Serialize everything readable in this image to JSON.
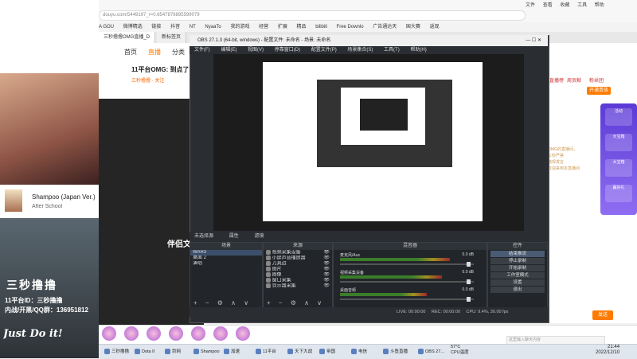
{
  "browser": {
    "url": "douyu.com/5449197_r=0.6547876895599079",
    "menu": [
      "文件",
      "查看",
      "收藏",
      "工具",
      "帮助"
    ],
    "bookmarks": [
      "A GOU",
      "微博精选",
      "链接",
      "抖音",
      "NT",
      "NyaaTo",
      "我的游戏",
      "经营",
      "扩展",
      "精品",
      "bilibili",
      "Free Downlo",
      "广告通达天",
      "国大赛",
      "返现"
    ],
    "tabs": [
      "三秒撸撸OMG直播_D",
      "新标签页"
    ]
  },
  "site": {
    "nav": [
      "首页",
      "直播",
      "分类"
    ],
    "room_title": "11平台OMG: 到点了",
    "room_sub": "三秒撸撸 · 关注",
    "caption": "伴侣文",
    "right_tabs": [
      "直播榜",
      "周贡献",
      "粉丝团"
    ],
    "open_button": "开通贵族",
    "chat_lines": [
      "OMG的直播间，",
      "三秒严禁",
      "违规发言",
      "欢迎来到本直播间"
    ],
    "promo": [
      "活动",
      "大宝箱",
      "大宝箱",
      "赢好礼"
    ],
    "send_button": "发送",
    "chat_placeholder": "这里输入聊天内容"
  },
  "left_overlay": {
    "now_playing_title": "Shampoo (Japan Ver.)",
    "now_playing_artist": "After School",
    "cam_title": "三秒撸撸",
    "cam_line1": "11平台ID：三秒撸撸",
    "cam_line2": "内战/开黑/QQ群：136951812",
    "cam_signature": "Just Do it!"
  },
  "obs": {
    "title": "OBS 27.1.3 (64-bit, windows) - 配置文件: 未命名 - 场景: 未命名",
    "menu": [
      "文件(F)",
      "编辑(E)",
      "视图(V)",
      "停靠窗口(D)",
      "配置文件(P)",
      "场景集合(S)",
      "工具(T)",
      "帮助(H)"
    ],
    "tabs": [
      "未选择源",
      "属性",
      "滤镜"
    ],
    "scenes_header": "场景",
    "scenes": [
      "WAR3",
      "桌面 2",
      "演唱"
    ],
    "sources_header": "来源",
    "sources": [
      "视频采集设备",
      "小屏声音播放器",
      "刀具边",
      "图片",
      "图像",
      "窗口采集",
      "显示器采集"
    ],
    "mixer_header": "混音器",
    "mixer": [
      {
        "name": "麦克风/Aux",
        "db": "0.0 dB",
        "level": 0.82
      },
      {
        "name": "视频采集设备",
        "db": "0.0 dB",
        "level": 0.76
      },
      {
        "name": "桌面音频",
        "db": "0.0 dB",
        "level": 0.65
      }
    ],
    "controls_header": "控件",
    "controls": [
      "结束推流",
      "停止录制",
      "开始录制",
      "工作室模式",
      "设置",
      "退出"
    ],
    "status": [
      "LIVE: 00:00:00",
      "REC: 00:00:00",
      "CPU: 9.4%, 30.00 fps"
    ]
  },
  "taskbar": {
    "items": [
      "三秒撸撸",
      "Dota II",
      "剑网",
      "Shampoo",
      "加速",
      "11平台",
      "天下大战",
      "帝国",
      "电信",
      "斗鱼直播",
      "OBS 27..."
    ],
    "weather": "57°C",
    "weather_label": "CPU温度",
    "time": "21:44",
    "date": "2022/12/10"
  },
  "colors": {
    "accent": "#ff7a00",
    "obs_bg": "#2a2e33"
  }
}
